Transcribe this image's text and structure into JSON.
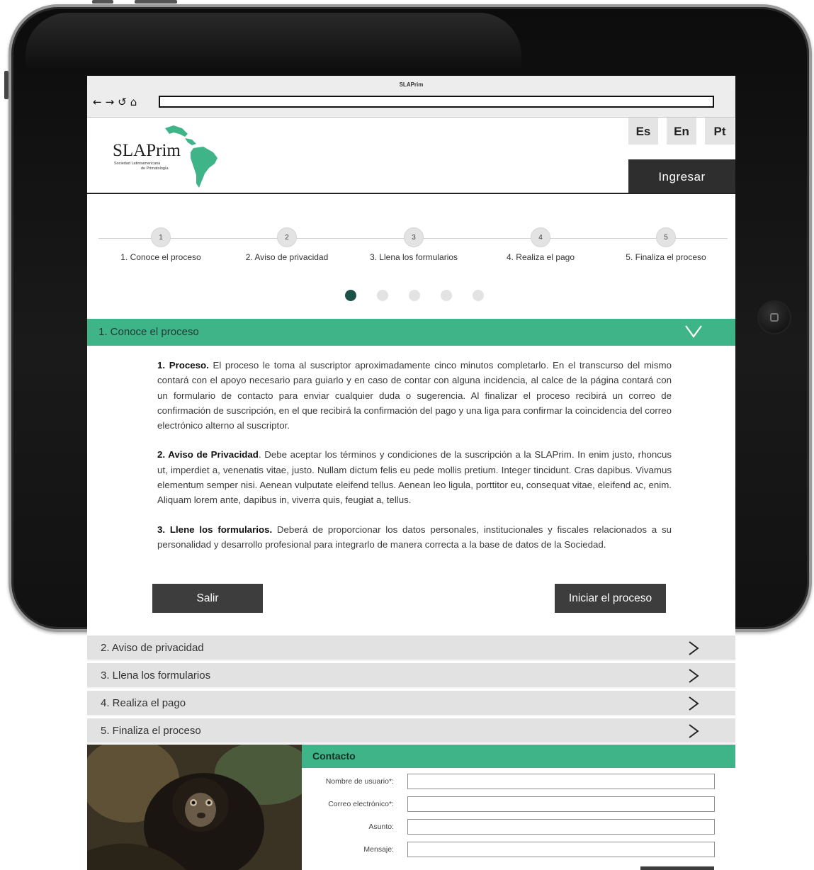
{
  "browser": {
    "title": "SLAPrim",
    "nav_icons": [
      "back-arrow-icon",
      "forward-arrow-icon",
      "reload-icon",
      "home-icon"
    ]
  },
  "header": {
    "logo_name": "SLAPrim",
    "logo_sub_line1": "Sociedad Latinoamericana",
    "logo_sub_line2": "de Primatología",
    "languages": [
      "Es",
      "En",
      "Pt"
    ],
    "login_label": "Ingresar"
  },
  "steps": [
    {
      "number": "1",
      "label": "1. Conoce el proceso"
    },
    {
      "number": "2",
      "label": "2. Aviso de privacidad"
    },
    {
      "number": "3",
      "label": "3. Llena los formularios"
    },
    {
      "number": "4",
      "label": "4. Realiza el pago"
    },
    {
      "number": "5",
      "label": "5. Finaliza el proceso"
    }
  ],
  "pager": {
    "count": 5,
    "active_index": 0
  },
  "accordion": {
    "active": {
      "label": "1. Conoce el proceso"
    },
    "content": {
      "p1_title": "1. Proceso.",
      "p1_text": " El proceso le toma al suscriptor aproximadamente cinco minutos completarlo. En el transcurso del mismo contará con el apoyo necesario para guiarlo y en caso de contar con alguna incidencia, al calce de la página contará con un formulario de contacto para enviar cualquier duda o sugerencia. Al finalizar el proceso recibirá un correo de confirmación de suscripción, en el que recibirá la confirmación del pago y una liga para confirmar la coincidencia del correo electrónico alterno al suscriptor.",
      "p2_title": "2. Aviso de Privacidad",
      "p2_text": ". Debe aceptar los términos y condiciones de la suscripción a la SLAPrim. In enim justo, rhoncus ut, imperdiet a, venenatis vitae, justo. Nullam dictum felis eu pede mollis pretium. Integer tincidunt. Cras dapibus. Vivamus elementum semper nisi. Aenean vulputate eleifend tellus. Aenean leo ligula, porttitor eu, consequat vitae, eleifend ac, enim. Aliquam lorem ante, dapibus in, viverra quis, feugiat a, tellus.",
      "p3_title": "3. Llene los formularios.",
      "p3_text": " Deberá de proporcionar los datos personales, institucionales y fiscales relacionados a su personalidad y desarrollo profesional para integrarlo de manera correcta a la base de datos de la Sociedad."
    },
    "exit_label": "Salir",
    "start_label": "Iniciar el proceso",
    "collapsed": [
      {
        "label": "2. Aviso de privacidad"
      },
      {
        "label": "3. Llena los formularios"
      },
      {
        "label": "4. Realiza el pago"
      },
      {
        "label": "5. Finaliza el proceso"
      }
    ]
  },
  "contact": {
    "title": "Contacto",
    "fields": [
      {
        "label": "Nombre de usuario*:",
        "value": ""
      },
      {
        "label": "Correo electrónico*:",
        "value": ""
      },
      {
        "label": "Asunto:",
        "value": ""
      },
      {
        "label": "Mensaje:",
        "value": ""
      }
    ]
  },
  "colors": {
    "accent": "#3fb489",
    "dark": "#2e2e2e",
    "pager_active": "#1d5249"
  }
}
